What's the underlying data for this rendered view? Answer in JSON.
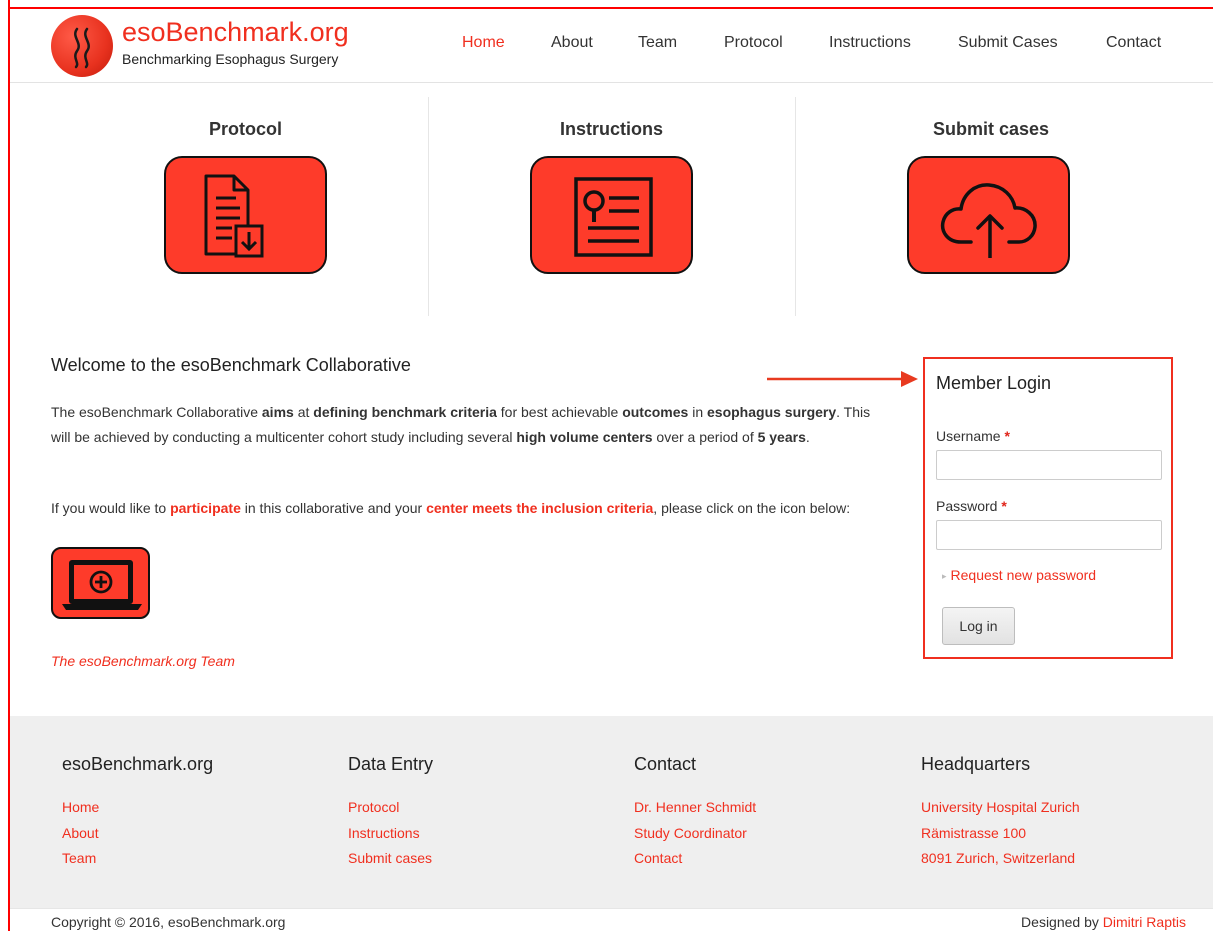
{
  "header": {
    "site_name": "esoBenchmark.org",
    "tagline": "Benchmarking Esophagus Surgery",
    "nav": [
      "Home",
      "About",
      "Team",
      "Protocol",
      "Instructions",
      "Submit Cases",
      "Contact"
    ],
    "active_nav": "Home"
  },
  "features": [
    {
      "title": "Protocol",
      "icon": "document-download-icon"
    },
    {
      "title": "Instructions",
      "icon": "instructions-list-icon"
    },
    {
      "title": "Submit cases",
      "icon": "cloud-upload-icon"
    }
  ],
  "welcome": {
    "title": "Welcome to the esoBenchmark Collaborative",
    "p1": {
      "t1": "The esoBenchmark Collaborative ",
      "b1": "aims",
      "t2": " at ",
      "b2": "defining benchmark criteria",
      "t3": " for best achievable ",
      "b3": "outcomes",
      "t4": " in ",
      "b4": "esophagus surgery",
      "t5": ". This will be achieved by conducting a multicenter cohort study including several ",
      "b5": "high volume centers",
      "t6": " over a period of ",
      "b6": "5 years",
      "t7": "."
    },
    "p2": {
      "t1": "If you would like to ",
      "r1": "participate",
      "t2": " in this collaborative and your ",
      "r2": "center meets the inclusion criteria",
      "t3": ", please click on the icon below:"
    },
    "participate_icon": "laptop-add-icon",
    "signature": "The esoBenchmark.org Team"
  },
  "login": {
    "title": "Member Login",
    "username_label": "Username",
    "password_label": "Password",
    "required_mark": "*",
    "username_value": "",
    "password_value": "",
    "request_password": "Request new password",
    "login_button": "Log in"
  },
  "footer": {
    "columns": [
      {
        "heading": "esoBenchmark.org",
        "links": [
          "Home",
          "About",
          "Team"
        ]
      },
      {
        "heading": "Data Entry",
        "links": [
          "Protocol",
          "Instructions",
          "Submit cases"
        ]
      },
      {
        "heading": "Contact",
        "links": [
          "Dr. Henner Schmidt",
          "Study Coordinator",
          "Contact"
        ]
      },
      {
        "heading": "Headquarters",
        "links": [
          "University Hospital Zurich",
          "Rämistrasse 100",
          "8091 Zurich, Switzerland"
        ]
      }
    ],
    "copyright": "Copyright © 2016, esoBenchmark.org",
    "designed_by_prefix": "Designed by ",
    "designed_by_name": "Dimitri Raptis"
  },
  "colors": {
    "accent": "#f02f1f",
    "icon_box": "#fe3b2a",
    "footer_bg": "#efefef"
  }
}
